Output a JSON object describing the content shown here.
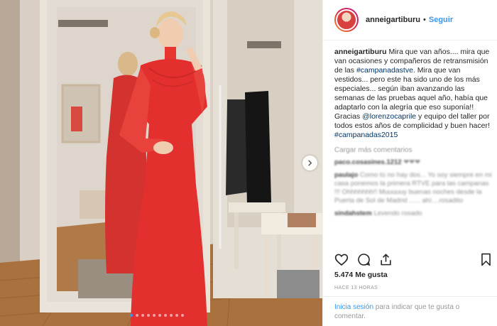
{
  "post": {
    "username": "anneigartiburu",
    "separator": "•",
    "follow_label": "Seguir",
    "caption_user": "anneigartiburu",
    "caption_parts": [
      "Mira que van años.... mira que van ocasiones y compañeros de retransmisión de las ",
      "#campanadastve",
      ". Mira que van vestidos... pero este ha sido uno de los más especiales... según iban avanzando las semanas de las pruebas aquel año, había que adaptarlo con la alegría que eso suponía!! Gracias ",
      "@lorenzocaprile",
      " y equipo del taller por todos estos años de complicidad y buen hacer!",
      "#campanadas2015"
    ],
    "load_more": "Cargar más comentarios",
    "comments": [
      {
        "user": "paco.cosasines.1212",
        "text": "❤❤❤"
      },
      {
        "user": "paulajo",
        "text": "Como tú no hay dos... Yo soy siempre en mi casa ponemos la primera RTVE para las campanas !!! Ohhhhhhh!! Muuuuuy buenas noches desde la Puerta de Sol de Madrid ...... ahí....rosadito"
      },
      {
        "user": "sindahstem",
        "text": "Levendo rosado"
      }
    ],
    "likes": "5.474 Me gusta",
    "time_ago": "HACE 13 HORAS",
    "footer_login": "Inicia sesión",
    "footer_text": " para indicar que te gusta o comentar."
  },
  "icons": {
    "like": "heart-outline-icon",
    "comment": "speech-bubble-icon",
    "share": "share-arrow-icon",
    "save": "bookmark-icon",
    "next": "chevron-right-icon"
  },
  "carousel": {
    "count": 10,
    "active_index": 0
  },
  "colors": {
    "link": "#3897f0",
    "hashtag": "#003569",
    "dress": "#e3302f"
  }
}
